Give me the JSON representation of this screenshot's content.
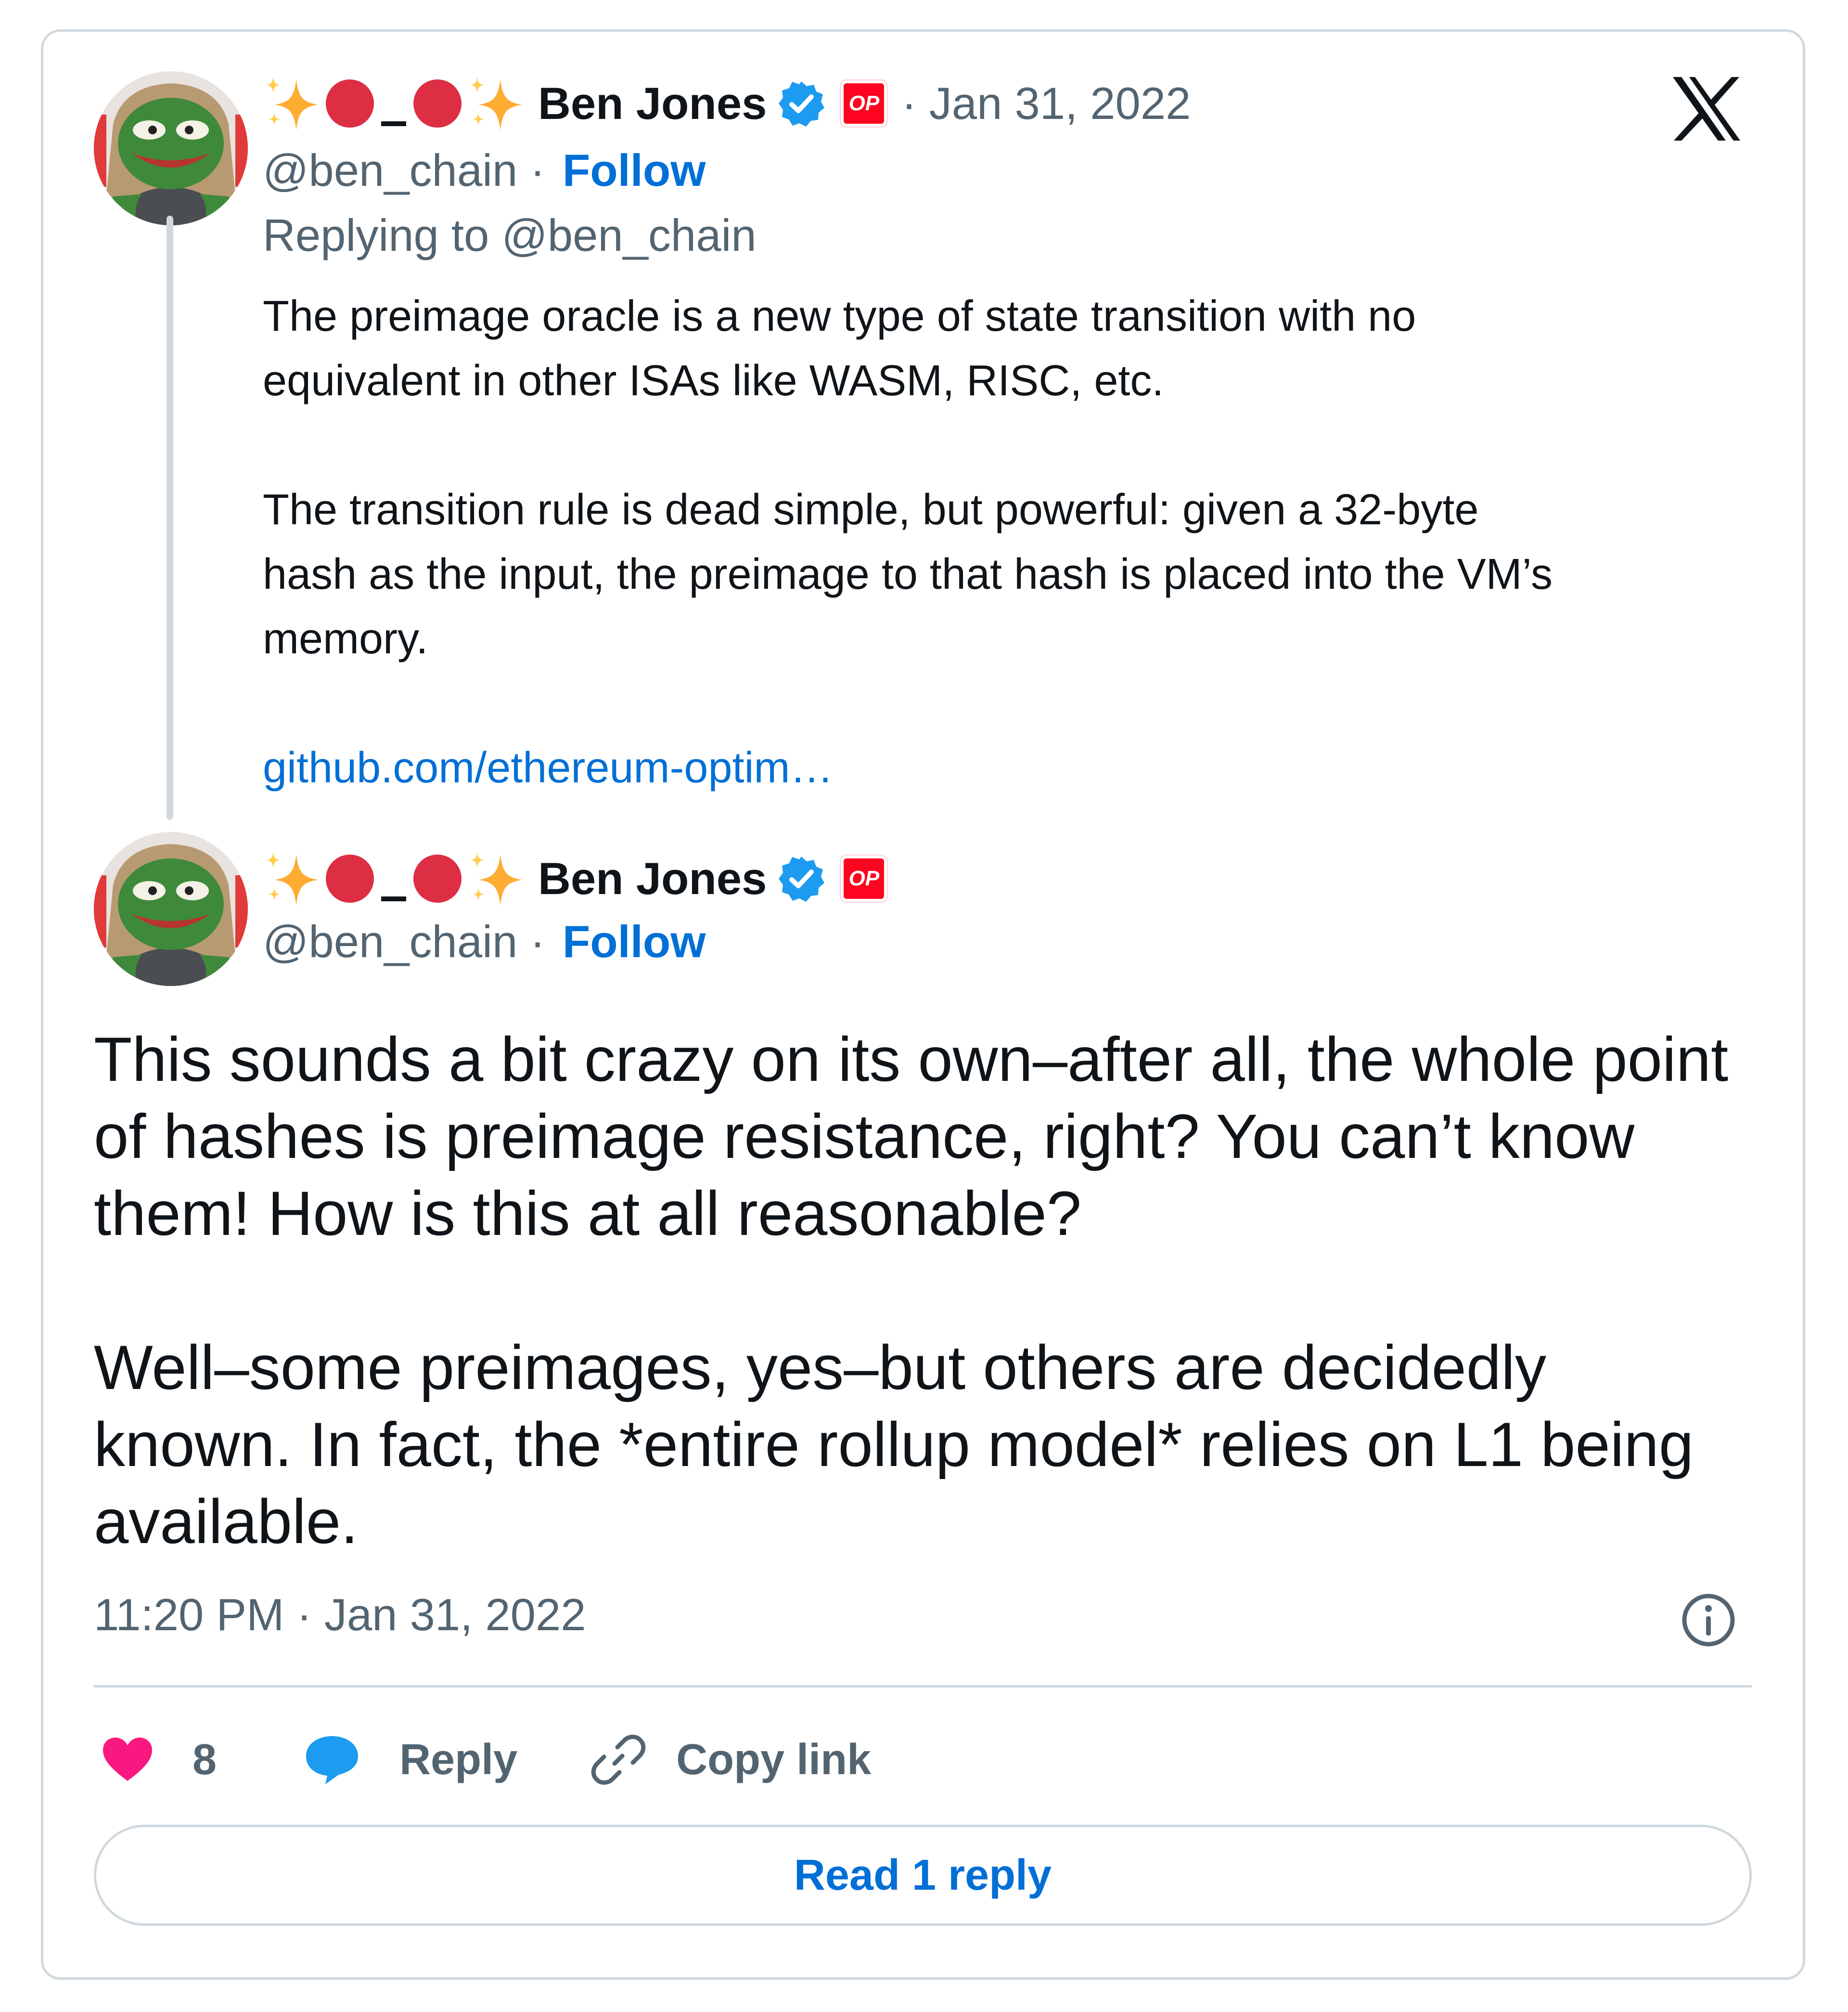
{
  "tweets": [
    {
      "display_name": "Ben Jones",
      "handle": "@ben_chain",
      "follow_label": "Follow",
      "date": "· Jan 31, 2022",
      "handle_sep": "·",
      "op_badge": "OP",
      "replying_to": "Replying to @ben_chain",
      "paragraphs": [
        "The preimage oracle is a new type of state transition with no\nequivalent in other ISAs like WASM, RISC, etc.",
        "The transition rule is dead simple, but powerful: given a 32-byte\nhash as the input, the preimage to that hash is placed into the VM’s\nmemory."
      ],
      "link": "github.com/ethereum-optim…"
    },
    {
      "display_name": "Ben Jones",
      "handle": "@ben_chain",
      "handle_sep": "·",
      "follow_label": "Follow",
      "op_badge": "OP",
      "paragraphs": [
        "This sounds a bit crazy on its own–after all, the whole point of hashes is preimage resistance, right? You can’t know them! How is this at all reasonable?",
        "Well–some preimages, yes–but others are decidedly known. In fact, the *entire rollup model* relies on L1 being available."
      ],
      "timestamp": "11:20 PM · Jan 31, 2022"
    }
  ],
  "actions": {
    "like_count": "8",
    "reply_label": "Reply",
    "copy_link_label": "Copy link"
  },
  "read_replies_label": "Read 1 reply",
  "icons": [
    "sparkle-icon",
    "red-circle-icon",
    "verified-badge-icon",
    "x-logo-icon",
    "info-icon",
    "heart-icon",
    "reply-bubble-icon",
    "link-icon"
  ],
  "colors": {
    "link": "#006fd6",
    "muted": "#536471",
    "verified": "#1d9bf0",
    "heart": "#f91880",
    "op_red": "#ff0420",
    "emoji_red": "#dd2e44",
    "sparkle": "#ffac33",
    "border": "#cfd9de"
  }
}
